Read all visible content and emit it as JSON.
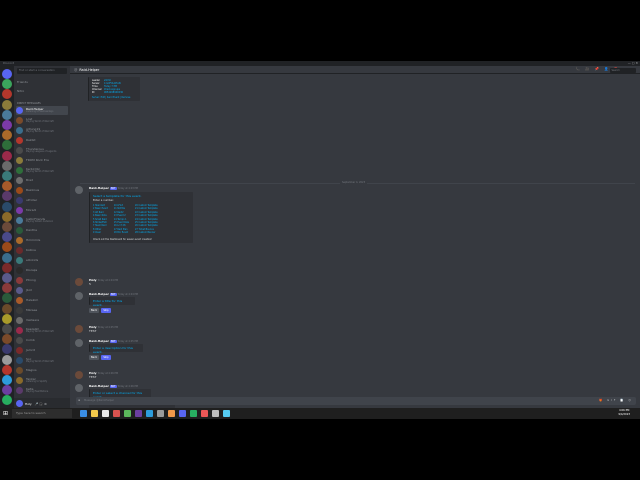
{
  "window": {
    "title": "Discord",
    "controls": "—  ▢  ✕"
  },
  "sidebar": {
    "search_placeholder": "Find or start a conversation",
    "items": [
      {
        "label": "Friends"
      },
      {
        "label": "Nitro"
      }
    ],
    "dm_header": "DIRECT MESSAGES",
    "dms": [
      {
        "name": "Raid-Helper",
        "status": "Listening to Wednesdays",
        "color": "#5865f2",
        "active": true
      },
      {
        "name": "Lost",
        "status": "Playing World of Warcraft",
        "color": "#7a4a2a"
      },
      {
        "name": "gitlung19",
        "status": "Playing World of Warcraft",
        "color": "#3a6d8c"
      },
      {
        "name": "Rakbit",
        "status": "",
        "color": "#b3372c"
      },
      {
        "name": "Thunderous",
        "status": "Playing Leagues of Legends",
        "color": "#4a4a4a"
      },
      {
        "name": "FROM Rock Era",
        "status": "",
        "color": "#8b7b3a"
      },
      {
        "name": "Kerbil Nic",
        "status": "Playing World of Warcraft",
        "color": "#2e6e3a"
      },
      {
        "name": "Brad",
        "status": "",
        "color": "#6d6d6d"
      },
      {
        "name": "Bazzinus",
        "status": "",
        "color": "#9a4a1a"
      },
      {
        "name": "uProtec",
        "status": "",
        "color": "#3a3a6d"
      },
      {
        "name": "Moradi",
        "status": "",
        "color": "#7b3aa8"
      },
      {
        "name": "JustinFriends",
        "status": "Playing Wiliam Anderson",
        "color": "#4a7a9a"
      },
      {
        "name": "Dantha",
        "status": "",
        "color": "#2a5a3a"
      },
      {
        "name": "Hmmmils",
        "status": "",
        "color": "#aa6a2a"
      },
      {
        "name": "Kollina",
        "status": "",
        "color": "#6a2a2a"
      },
      {
        "name": "eOnkids",
        "status": "",
        "color": "#3a7a7a"
      },
      {
        "name": "Disraps",
        "status": "",
        "color": "#2a2a2a"
      },
      {
        "name": "Ptrong",
        "status": "",
        "color": "#8a3a3a"
      },
      {
        "name": "Jbot",
        "status": "",
        "color": "#5a5a8a"
      },
      {
        "name": "Halekim",
        "status": "",
        "color": "#a85a2a"
      },
      {
        "name": "Mzzaee",
        "status": "",
        "color": "#3a3a3a"
      },
      {
        "name": "Valdaara",
        "status": "",
        "color": "#6a6a6a"
      },
      {
        "name": "Kaszalim",
        "status": "Playing World of Warcraft",
        "color": "#9a2a4a"
      },
      {
        "name": "Comb",
        "status": "",
        "color": "#4a4a4a"
      },
      {
        "name": "Jamrit",
        "status": "",
        "color": "#7a2a2a"
      },
      {
        "name": "Soc",
        "status": "Playing World of Warcraft",
        "color": "#2a4a6a"
      },
      {
        "name": "Magios",
        "status": "",
        "color": "#6a4a2a"
      },
      {
        "name": "Tankar",
        "status": "Listening to Spotify",
        "color": "#8a6a2a"
      },
      {
        "name": "Kelta",
        "status": "Playing Hearthstone",
        "color": "#5a3a6a"
      }
    ],
    "user": {
      "name": "Holy",
      "icons": "🎤 🎧 ⚙"
    }
  },
  "chat": {
    "channel": "Raid-Helper",
    "search_placeholder": "Search",
    "header_icons": "📞 🎥 📌 👤 ❓",
    "early_embed": {
      "rows": [
        {
          "k": "Leader",
          "v": "shhhh"
        },
        {
          "k": "Server",
          "v": "4 GUFULCHAN"
        },
        {
          "k": "Time",
          "v": "Today 7 PM"
        },
        {
          "k": "Channel",
          "v": "#raid-signups"
        },
        {
          "k": "ID",
          "v": "9054298940236"
        }
      ],
      "footer": "Server: Edit  |  Send Event  |  Remove"
    },
    "date_divider": "September 4, 2023",
    "messages": [
      {
        "author": "Raid-Helper",
        "bot": true,
        "time": "Today at 4:03 PM",
        "embed_title": "Select a template for this event.",
        "embed_sub": "Enter a number.",
        "col1": [
          "1 Standard",
          "2 Basic Event",
          "3 Alt Raid",
          "4 Basic Rota",
          "5 Small Raid",
          "6 Strike/ESO",
          "7 Team Raid",
          "8 Other",
          "9 Clear"
        ],
        "col2": [
          "10 LFG3",
          "11 NoTitle",
          "12 Raid2",
          "13 Event 2",
          "14 Tempo 1",
          "15 Event Role",
          "16 Lcl 3 Pk",
          "17 Raid Plan",
          "18 Bnr Event"
        ],
        "col3": [
          "20 Custom Template",
          "21 Custom Template",
          "22 Custom Template",
          "23 Custom Template",
          "24 Custom Template",
          "25 Custom Template",
          "26 Custom Template",
          "27 Ticket Bounce",
          "28 Custom Banner"
        ],
        "embed_footer": "Check out the Dashboard for easier event creation!"
      },
      {
        "author": "Holy",
        "bot": false,
        "time": "Today at 4:04 PM",
        "text": "5"
      },
      {
        "author": "Raid-Helper",
        "bot": true,
        "time": "Today at 4:04 PM",
        "embed_title": "Enter a title for this event.",
        "buttons": [
          "Back",
          "Skip"
        ]
      },
      {
        "author": "Holy",
        "bot": false,
        "time": "Today at 4:05 PM",
        "text": "TEST"
      },
      {
        "author": "Raid-Helper",
        "bot": true,
        "time": "Today at 4:05 PM",
        "embed_title": "Enter a description for this event.",
        "buttons": [
          "Back",
          "Skip"
        ]
      },
      {
        "author": "Holy",
        "bot": false,
        "time": "Today at 4:06 PM",
        "text": "TEST"
      },
      {
        "author": "Raid-Helper",
        "bot": true,
        "time": "Today at 4:06 PM",
        "embed_title": "Enter or select a channel for this event.",
        "embed_sub": "Type '0' to default to the current channel.",
        "select_placeholder": "Select channel",
        "date_title": "Enter a date.",
        "date_headers": [
          "Format",
          "Example"
        ],
        "date_values": [
          "dd-MM-yyyy",
          "24-08-2023"
        ],
        "back": "Back"
      }
    ],
    "composer_placeholder": "Message @Raid-Helper",
    "composer_icons": "🎁 GIF 📄 😊"
  },
  "taskbar": {
    "search_placeholder": "Type here to search",
    "apps": [
      "#3a8ee6",
      "#f2c94c",
      "#e8e8e8",
      "#d9534f",
      "#5cb85c",
      "#6b3fa0",
      "#2d9cdb",
      "#9b9b9b",
      "#f2994a",
      "#5865f2",
      "#27ae60",
      "#eb5757",
      "#bdbdbd",
      "#56ccf2"
    ],
    "time": "4:06 PM",
    "date": "9/4/2023"
  },
  "colors": {
    "accent": "#5865f2",
    "link": "#00aff4",
    "bg": "#36393f",
    "sidebar": "#2f3136"
  }
}
